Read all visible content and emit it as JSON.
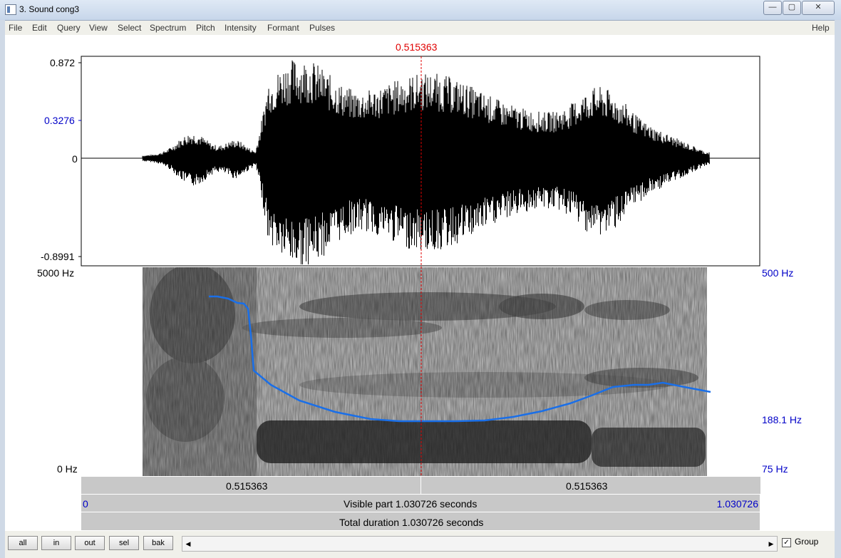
{
  "window": {
    "title": "3. Sound cong3",
    "min_label": "—",
    "max_label": "▢",
    "close_label": "✕"
  },
  "menu": [
    "File",
    "Edit",
    "Query",
    "View",
    "Select",
    "Spectrum",
    "Pitch",
    "Intensity",
    "Formant",
    "Pulses"
  ],
  "help": "Help",
  "cursor": "0.515363",
  "waveform": {
    "ymax": "0.872",
    "ymid": "0.3276",
    "yzero": "0",
    "ymin": "-0.8991"
  },
  "spectrogram": {
    "freq_top": "5000 Hz",
    "freq_bottom": "0 Hz",
    "pitch_top": "500 Hz",
    "pitch_mid": "188.1 Hz",
    "pitch_bottom": "75 Hz"
  },
  "time_bars": {
    "left_time": "0.515363",
    "right_time": "0.515363",
    "start": "0",
    "end": "1.030726",
    "visible": "Visible part 1.030726 seconds",
    "total": "Total duration 1.030726 seconds"
  },
  "buttons": {
    "all": "all",
    "in": "in",
    "out": "out",
    "sel": "sel",
    "bak": "bak"
  },
  "group": {
    "label": "Group",
    "checked": "✓"
  },
  "colors": {
    "pitch_line": "#1a6fe8",
    "cursor": "#e00000",
    "axis_blue": "#0000c8"
  }
}
